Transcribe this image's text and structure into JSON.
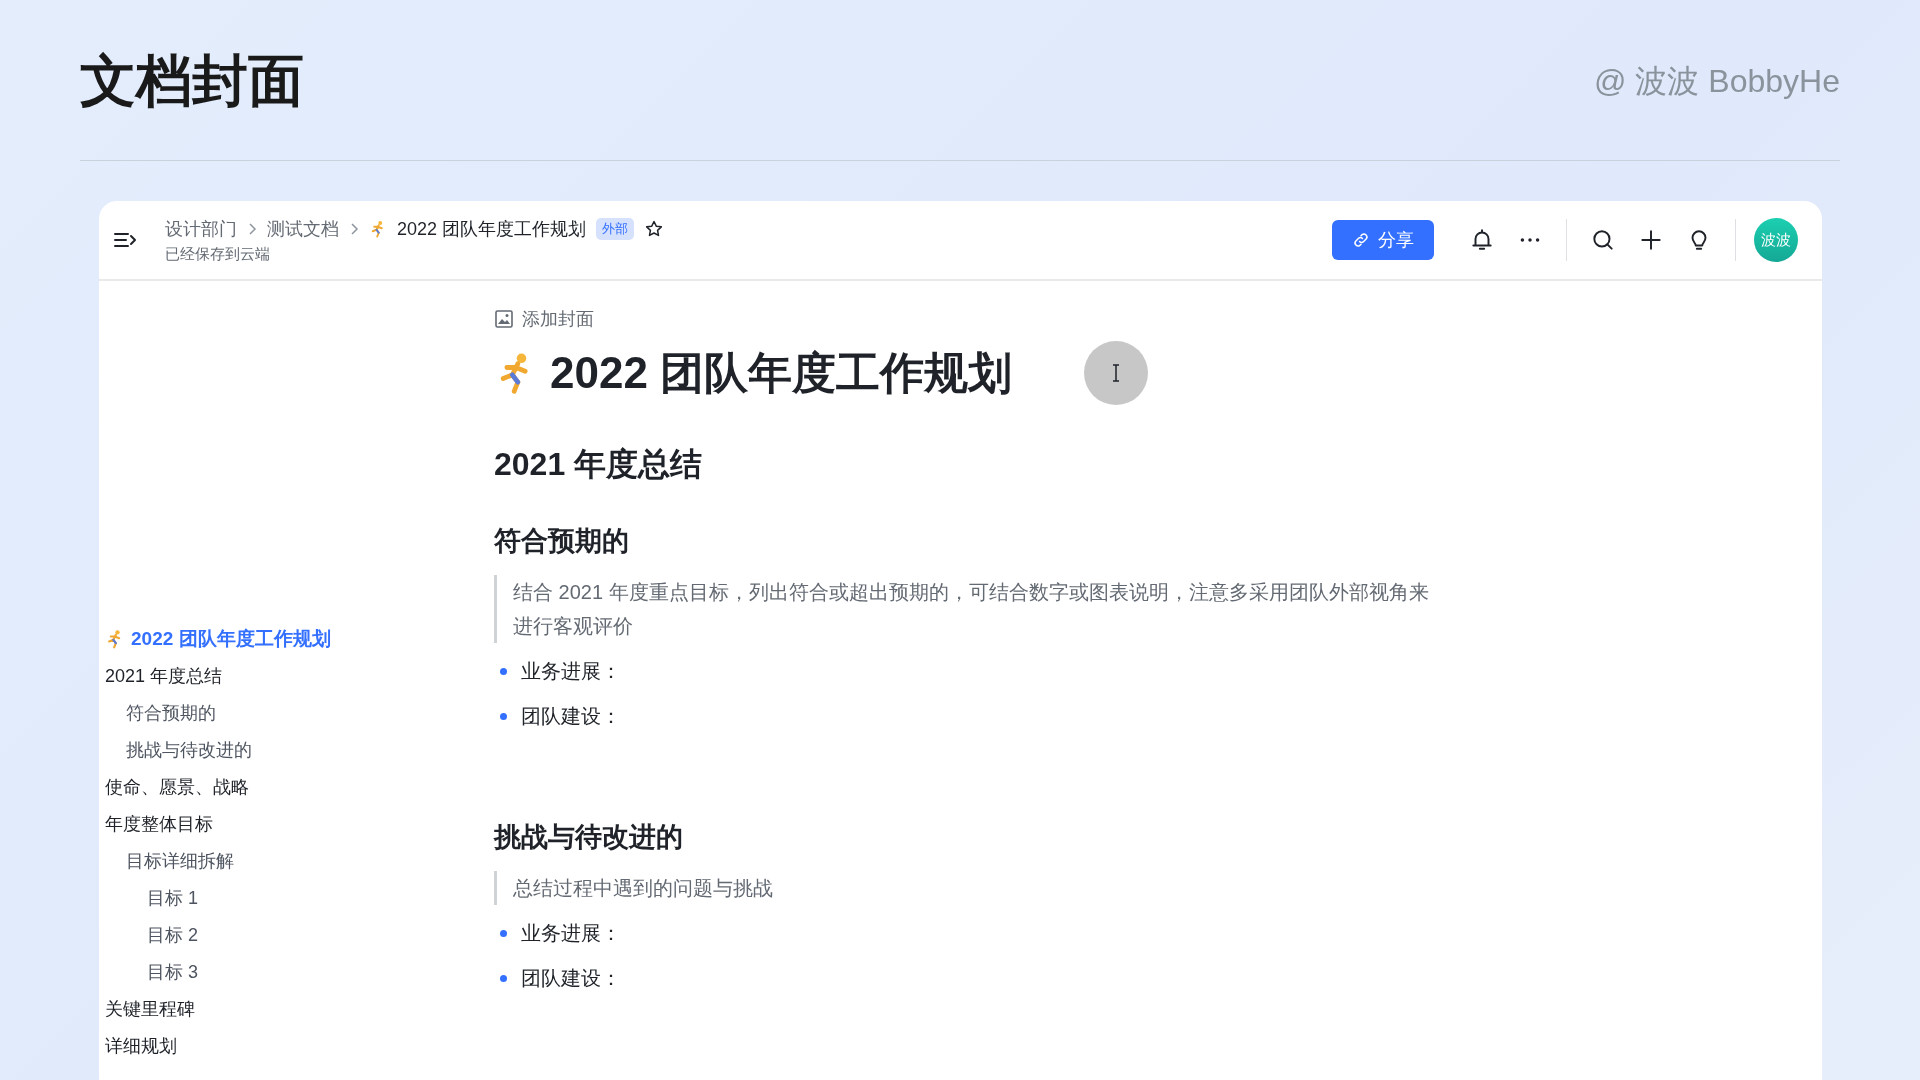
{
  "page": {
    "title": "文档封面",
    "author": "@ 波波 BobbyHe"
  },
  "header": {
    "breadcrumbs": [
      "设计部门",
      "测试文档"
    ],
    "doc_title": "2022 团队年度工作规划",
    "badge": "外部",
    "status": "已经保存到云端",
    "share_button": "分享",
    "avatar": "波波"
  },
  "outline": [
    {
      "label": "2022 团队年度工作规划",
      "kind": "doc",
      "selected": true
    },
    {
      "label": "2021 年度总结",
      "kind": "heading",
      "selected": false,
      "children": [
        {
          "label": "符合预期的",
          "kind": "heading",
          "selected": false
        },
        {
          "label": "挑战与待改进的",
          "kind": "heading",
          "selected": false
        }
      ]
    },
    {
      "label": "使命、愿景、战略",
      "kind": "heading",
      "selected": false
    },
    {
      "label": "年度整体目标",
      "kind": "heading",
      "selected": false,
      "children": [
        {
          "label": "目标详细拆解",
          "kind": "heading",
          "selected": false,
          "children": [
            {
              "label": "目标 1",
              "kind": "heading",
              "selected": false
            },
            {
              "label": "目标 2",
              "kind": "heading",
              "selected": false
            },
            {
              "label": "目标 3",
              "kind": "heading",
              "selected": false
            }
          ]
        }
      ]
    },
    {
      "label": "关键里程碑",
      "kind": "heading",
      "selected": false
    },
    {
      "label": "详细规划",
      "kind": "heading",
      "selected": false
    }
  ],
  "document": {
    "add_cover": "添加封面",
    "title": "2022 团队年度工作规划",
    "blocks": [
      {
        "kind": "heading1",
        "text": "2021 年度总结"
      },
      {
        "kind": "heading2",
        "text": "符合预期的"
      },
      {
        "kind": "quote",
        "text": "结合 2021 年度重点目标，列出符合或超出预期的，可结合数字或图表说明，注意多采用团队外部视角来进行客观评价"
      },
      {
        "kind": "bullet",
        "text": "业务进展："
      },
      {
        "kind": "bullet",
        "text": "团队建设："
      },
      {
        "kind": "heading2",
        "text": "挑战与待改进的"
      },
      {
        "kind": "quote",
        "text": "总结过程中遇到的问题与挑战"
      },
      {
        "kind": "bullet",
        "text": "业务进展："
      },
      {
        "kind": "bullet",
        "text": "团队建设："
      }
    ]
  }
}
